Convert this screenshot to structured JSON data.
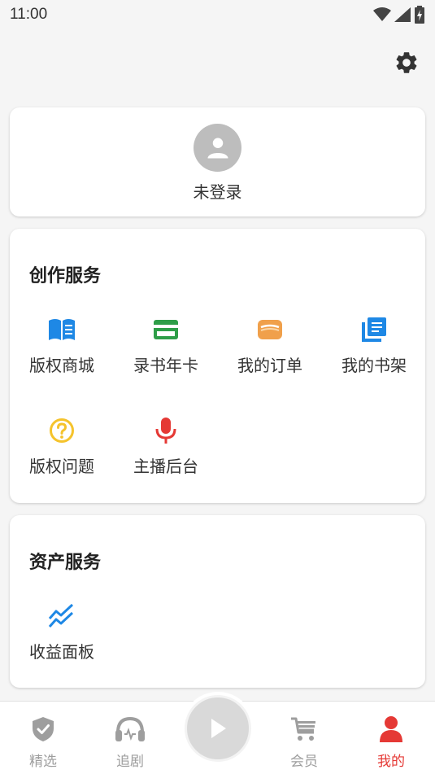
{
  "status_bar": {
    "time": "11:00"
  },
  "settings": {
    "icon": "gear-icon"
  },
  "profile": {
    "login_label": "未登录",
    "avatar_icon": "person-icon"
  },
  "creation_services": {
    "title": "创作服务",
    "items": [
      {
        "label": "版权商城",
        "icon": "open-book-icon",
        "color": "#1e88e5"
      },
      {
        "label": "录书年卡",
        "icon": "card-icon",
        "color": "#2e9e48"
      },
      {
        "label": "我的订单",
        "icon": "wallet-icon",
        "color": "#f0a04b"
      },
      {
        "label": "我的书架",
        "icon": "library-icon",
        "color": "#1e88e5"
      },
      {
        "label": "版权问题",
        "icon": "question-icon",
        "color": "#f5c32c"
      },
      {
        "label": "主播后台",
        "icon": "mic-icon",
        "color": "#e53935"
      }
    ]
  },
  "asset_services": {
    "title": "资产服务",
    "items": [
      {
        "label": "收益面板",
        "icon": "trend-icon",
        "color": "#1e88e5"
      }
    ]
  },
  "bottom_nav": {
    "items": [
      {
        "label": "精选",
        "icon": "shield-check-icon",
        "active": false
      },
      {
        "label": "追剧",
        "icon": "headphones-icon",
        "active": false
      },
      {
        "label": "会员",
        "icon": "cart-icon",
        "active": false
      },
      {
        "label": "我的",
        "icon": "person-icon",
        "active": true
      }
    ],
    "accent": "#e53935",
    "inactive": "#9e9e9e"
  }
}
